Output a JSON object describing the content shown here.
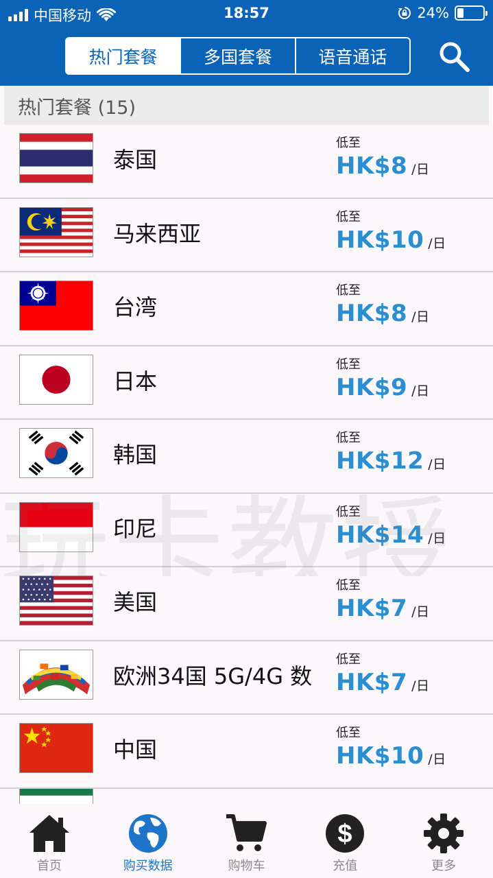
{
  "status_bar": {
    "carrier": "中国移动",
    "time": "18:57",
    "battery": "24%",
    "battery_level": 0.24
  },
  "header": {
    "tabs": [
      {
        "label": "热门套餐",
        "active": true
      },
      {
        "label": "多国套餐",
        "active": false
      },
      {
        "label": "语音通话",
        "active": false
      }
    ],
    "search_icon": "search-icon"
  },
  "section": {
    "title": "热门套餐 (15)"
  },
  "list": {
    "from_label": "低至",
    "unit": "/日",
    "items": [
      {
        "name": "泰国",
        "price": "HK$8",
        "flag": "thailand-flag-icon"
      },
      {
        "name": "马来西亚",
        "price": "HK$10",
        "flag": "malaysia-flag-icon"
      },
      {
        "name": "台湾",
        "price": "HK$8",
        "flag": "taiwan-flag-icon"
      },
      {
        "name": "日本",
        "price": "HK$9",
        "flag": "japan-flag-icon"
      },
      {
        "name": "韩国",
        "price": "HK$12",
        "flag": "korea-flag-icon"
      },
      {
        "name": "印尼",
        "price": "HK$14",
        "flag": "indonesia-flag-icon"
      },
      {
        "name": "美国",
        "price": "HK$7",
        "flag": "usa-flag-icon"
      },
      {
        "name": "欧洲34国 5G/4G 数",
        "price": "HK$7",
        "flag": "europe-flags-icon"
      },
      {
        "name": "中国",
        "price": "HK$10",
        "flag": "china-flag-icon"
      }
    ]
  },
  "watermark": "玩卡教授",
  "tabbar": {
    "items": [
      {
        "label": "首页",
        "icon": "home-icon",
        "active": false
      },
      {
        "label": "购买数据",
        "icon": "globe-icon",
        "active": true
      },
      {
        "label": "购物车",
        "icon": "cart-icon",
        "active": false
      },
      {
        "label": "充值",
        "icon": "dollar-icon",
        "active": false
      },
      {
        "label": "更多",
        "icon": "gear-icon",
        "active": false
      }
    ]
  },
  "colors": {
    "header_blue": "#0a63b7",
    "price_blue": "#2a8ed1",
    "active_tab": "#1e74c8",
    "inactive_tab": "#8a8a8a"
  }
}
